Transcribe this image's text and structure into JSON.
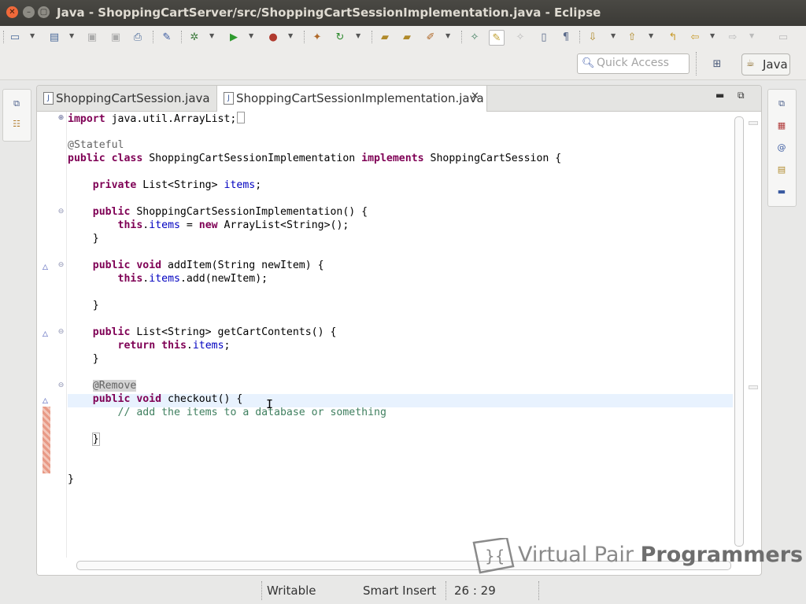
{
  "window": {
    "title": "Java - ShoppingCartServer/src/ShoppingCartSessionImplementation.java - Eclipse"
  },
  "toolbar": {
    "icons": [
      "new-icon",
      "new-package-icon",
      "save-icon",
      "save-all-icon",
      "print-icon",
      "pin-icon",
      "debug-icon",
      "run-icon",
      "run-external-icon",
      "new-java-project-icon",
      "refresh-icon",
      "open-folder-icon",
      "open-type-icon",
      "search-icon",
      "annotation-icon",
      "highlight-icon",
      "toggle-icon",
      "block-select-icon",
      "show-whitespace-icon",
      "next-annotation-icon",
      "prev-annotation-icon",
      "back-icon",
      "forward-icon",
      "last-edit-icon"
    ]
  },
  "quick_access": {
    "placeholder": "Quick Access"
  },
  "perspective": {
    "label": "Java"
  },
  "tabs": [
    {
      "label": "ShoppingCartSession.java"
    },
    {
      "label": "ShoppingCartSessionImplementation.java",
      "close": "✕"
    }
  ],
  "code": {
    "import_line": "import java.util.ArrayList;",
    "annotation_stateful": "@Stateful",
    "class_decl_kw": "public class",
    "class_name": " ShoppingCartSessionImplementation ",
    "implements_kw": "implements",
    "interface_name": " ShoppingCartSession {",
    "field_kw": "private",
    "field_type": " List<String> ",
    "field_name": "items",
    "semicolon": ";",
    "ctor_kw": "public",
    "ctor_sig": " ShoppingCartSessionImplementation() {",
    "this_kw": "this",
    "dot": ".",
    "items": "items",
    "assign": " = ",
    "new_kw": "new",
    "new_expr": " ArrayList<String>();",
    "close_brace": "}",
    "public_void": "public void",
    "add_sig": " addItem(String newItem) {",
    "add_call": ".add(newItem);",
    "public_kw": "public",
    "get_sig": " List<String> getCartContents() {",
    "return_kw": "return",
    "annotation_remove": "@Remove",
    "checkout_sig": " checkout() {",
    "comment": "// add the items to a database or something"
  },
  "status": {
    "writable": "Writable",
    "insert_mode": "Smart Insert",
    "position": "26 : 29"
  },
  "watermark": {
    "text1": "Virtual Pair ",
    "text2": "Programmers"
  }
}
